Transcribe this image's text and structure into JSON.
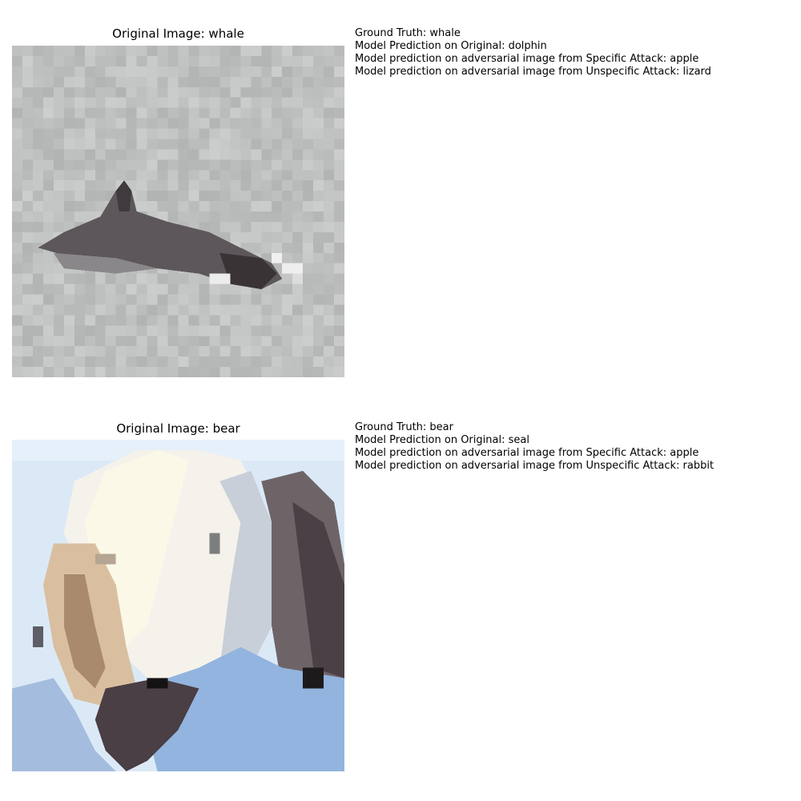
{
  "panels": [
    {
      "title": "Original Image: whale",
      "lines": [
        "Ground Truth: whale",
        "Model Prediction on Original: dolphin",
        "Model prediction on adversarial image from Specific Attack: apple",
        "Model prediction on adversarial image from Unspecific Attack: lizard"
      ],
      "image_subject": "dolphin-photo"
    },
    {
      "title": "Original Image: bear",
      "lines": [
        "Ground Truth: bear",
        "Model Prediction on Original: seal",
        "Model prediction on adversarial image from Specific Attack: apple",
        "Model prediction on adversarial image from Unspecific Attack: rabbit"
      ],
      "image_subject": "polar-bear-photo"
    }
  ],
  "colors": {
    "background": "#ffffff",
    "text": "#000000",
    "whale_bg": "#c8cbc9",
    "whale_body": "#5b5659",
    "bear_sky": "#d9e8f7",
    "bear_fur": "#f2f0e8",
    "bear_shadow": "#4a4045",
    "bear_water": "#8fb0dc"
  }
}
